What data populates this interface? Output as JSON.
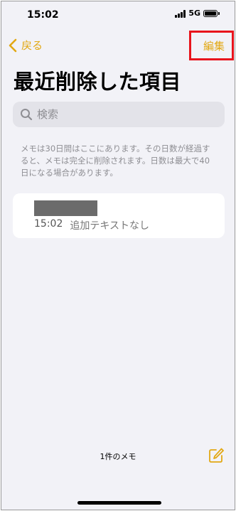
{
  "status_bar": {
    "time": "15:02",
    "network": "5G",
    "icons": [
      "signal-icon",
      "battery-icon"
    ]
  },
  "nav": {
    "back_label": "戻る",
    "back_icon": "chevron-left-icon",
    "edit_label": "編集",
    "accent_color": "#e2a814",
    "highlight_color": "#e8141c"
  },
  "page_title": "最近削除した項目",
  "search": {
    "placeholder": "検索",
    "icon": "search-icon"
  },
  "info_text": "メモは30日間はここにあります。その日数が経過すると、メモは完全に削除されます。日数は最大で40日になる場合があります。",
  "notes": [
    {
      "time": "15:02",
      "preview": "追加テキストなし"
    }
  ],
  "footer": {
    "count_label": "1件のメモ",
    "compose_icon": "compose-icon"
  }
}
